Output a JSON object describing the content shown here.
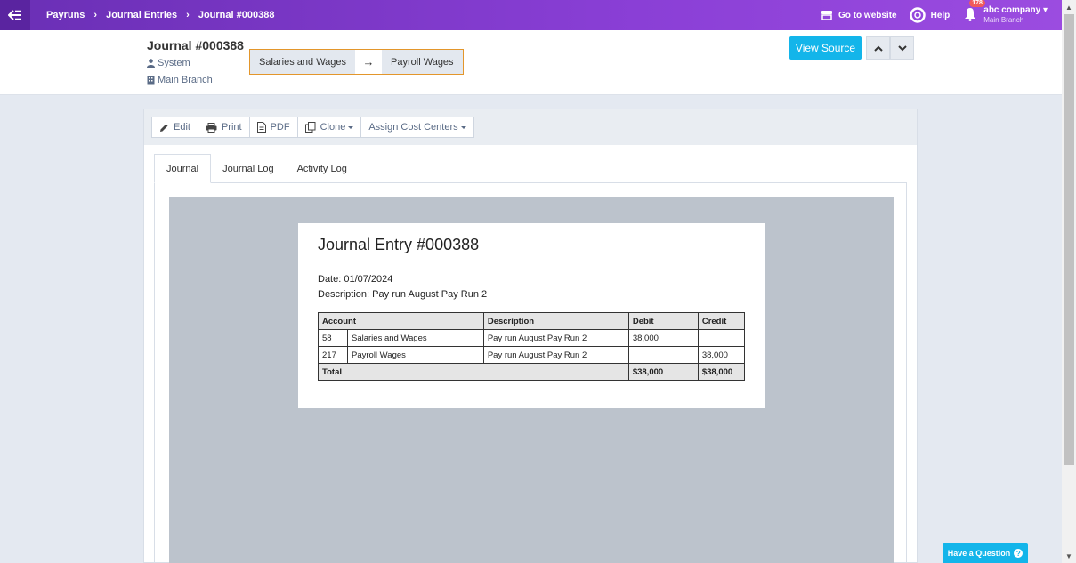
{
  "breadcrumb": [
    "Payruns",
    "Journal Entries",
    "Journal #000388"
  ],
  "topbar": {
    "go_to_website": "Go to website",
    "help": "Help",
    "notifications_count": "178",
    "company_name": "abc company",
    "company_branch": "Main Branch"
  },
  "header": {
    "title": "Journal #000388",
    "created_by": "System",
    "branch": "Main Branch",
    "flow_from": "Salaries and Wages",
    "flow_arrow": "→",
    "flow_to": "Payroll Wages",
    "view_source": "View Source"
  },
  "toolbar": {
    "edit": "Edit",
    "print": "Print",
    "pdf": "PDF",
    "clone": "Clone",
    "assign_cost_centers": "Assign Cost Centers"
  },
  "tabs": [
    "Journal",
    "Journal Log",
    "Activity Log"
  ],
  "document": {
    "title": "Journal Entry #000388",
    "date_label": "Date: 01/07/2024",
    "description_label": "Description: Pay run August Pay Run 2",
    "columns": [
      "Account",
      "Description",
      "Debit",
      "Credit"
    ],
    "rows": [
      {
        "code": "58",
        "account": "Salaries and Wages",
        "description": "Pay run August Pay Run 2",
        "debit": "38,000",
        "credit": ""
      },
      {
        "code": "217",
        "account": "Payroll Wages",
        "description": "Pay run August Pay Run 2",
        "debit": "",
        "credit": "38,000"
      }
    ],
    "total_label": "Total",
    "total_debit": "$38,000",
    "total_credit": "$38,000"
  },
  "help_widget": {
    "label": "Have a Question",
    "icon": "?"
  },
  "colors": {
    "topbar": "#7b35c8",
    "accent": "#13b5ea",
    "flow_border": "#e3962b"
  }
}
